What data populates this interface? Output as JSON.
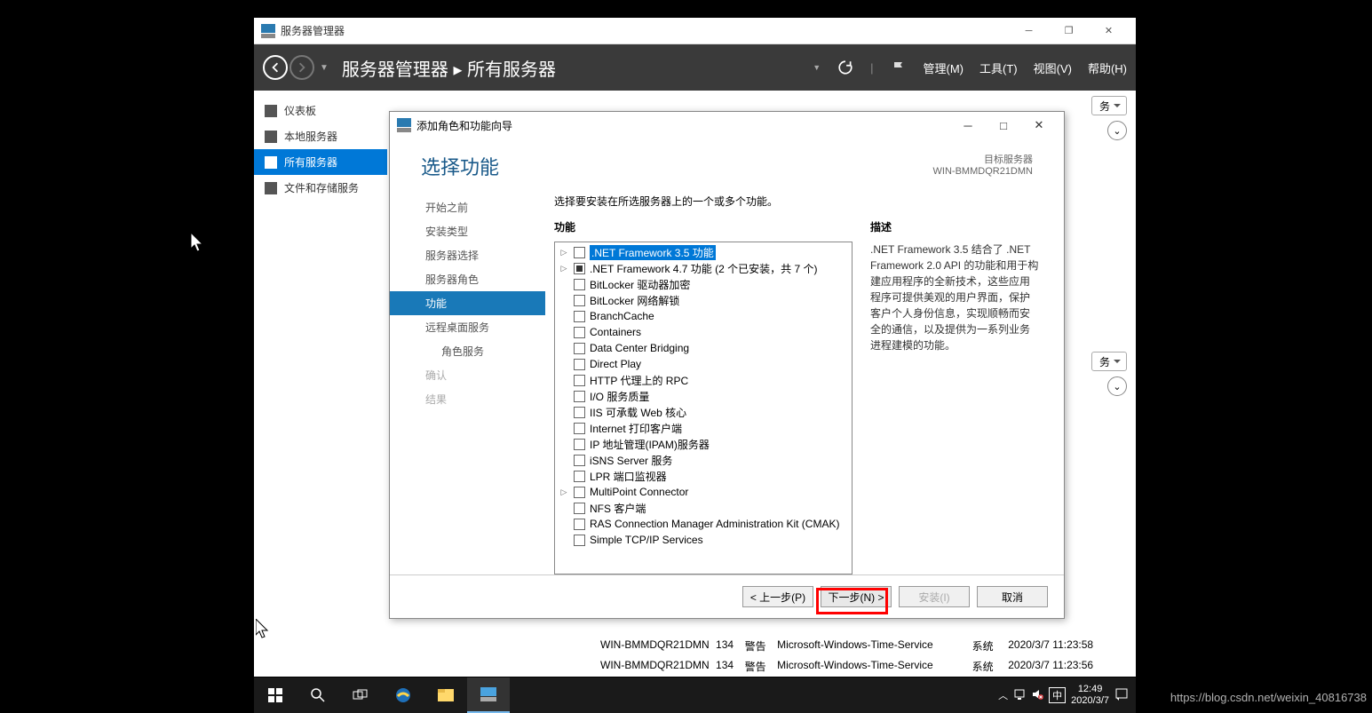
{
  "parent_window": {
    "title": "服务器管理器",
    "breadcrumb": "服务器管理器 ▸ 所有服务器",
    "menu": {
      "manage": "管理(M)",
      "tools": "工具(T)",
      "view": "视图(V)",
      "help": "帮助(H)"
    },
    "sidebar": [
      {
        "label": "仪表板"
      },
      {
        "label": "本地服务器"
      },
      {
        "label": "所有服务器",
        "active": true
      },
      {
        "label": "文件和存储服务"
      }
    ],
    "right_pill_1": "务",
    "right_pill_2": "务",
    "events": [
      {
        "server": "WIN-BMMDQR21DMN",
        "id": "134",
        "level": "警告",
        "source": "Microsoft-Windows-Time-Service",
        "log": "系统",
        "time": "2020/3/7 11:23:58"
      },
      {
        "server": "WIN-BMMDQR21DMN",
        "id": "134",
        "level": "警告",
        "source": "Microsoft-Windows-Time-Service",
        "log": "系统",
        "time": "2020/3/7 11:23:56"
      }
    ]
  },
  "wizard": {
    "title": "添加角色和功能向导",
    "heading": "选择功能",
    "target_label": "目标服务器",
    "target_server": "WIN-BMMDQR21DMN",
    "nav": {
      "before": "开始之前",
      "type": "安装类型",
      "server_sel": "服务器选择",
      "roles": "服务器角色",
      "features": "功能",
      "rds": "远程桌面服务",
      "role_svc": "角色服务",
      "confirm": "确认",
      "result": "结果"
    },
    "intro": "选择要安装在所选服务器上的一个或多个功能。",
    "col_features": "功能",
    "col_desc": "描述",
    "features": [
      {
        "label": ".NET Framework 3.5 功能",
        "expander": true,
        "selected": true
      },
      {
        "label": ".NET Framework 4.7 功能 (2 个已安装，共 7 个)",
        "expander": true,
        "partial": true
      },
      {
        "label": "BitLocker 驱动器加密"
      },
      {
        "label": "BitLocker 网络解锁"
      },
      {
        "label": "BranchCache"
      },
      {
        "label": "Containers"
      },
      {
        "label": "Data Center Bridging"
      },
      {
        "label": "Direct Play"
      },
      {
        "label": "HTTP 代理上的 RPC"
      },
      {
        "label": "I/O 服务质量"
      },
      {
        "label": "IIS 可承载 Web 核心"
      },
      {
        "label": "Internet 打印客户端"
      },
      {
        "label": "IP 地址管理(IPAM)服务器"
      },
      {
        "label": "iSNS Server 服务"
      },
      {
        "label": "LPR 端口监视器"
      },
      {
        "label": "MultiPoint Connector",
        "expander": true
      },
      {
        "label": "NFS 客户端"
      },
      {
        "label": "RAS Connection Manager Administration Kit (CMAK)"
      },
      {
        "label": "Simple TCP/IP Services"
      }
    ],
    "description": ".NET Framework 3.5 结合了 .NET Framework 2.0 API 的功能和用于构建应用程序的全新技术，这些应用程序可提供美观的用户界面，保护客户个人身份信息，实现顺畅而安全的通信，以及提供为一系列业务进程建模的功能。",
    "buttons": {
      "prev": "< 上一步(P)",
      "next": "下一步(N) >",
      "install": "安装(I)",
      "cancel": "取消"
    }
  },
  "taskbar": {
    "ime": "中",
    "time": "12:49",
    "date": "2020/3/7"
  },
  "watermark": "https://blog.csdn.net/weixin_40816738"
}
